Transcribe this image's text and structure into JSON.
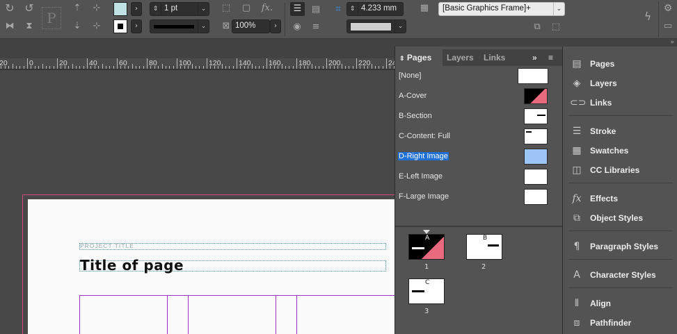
{
  "control_bar": {
    "stroke_weight": "1 pt",
    "scale_percent": "100%",
    "dimension_value": "4.233 mm",
    "object_style": "[Basic Graphics Frame]+",
    "colors": {
      "fill_swatch": "#bfe3e3",
      "stroke_swatch": "#000000"
    },
    "icons": [
      "rotate-left-icon",
      "rotate-right-icon",
      "text-frame-icon",
      "flip-horizontal-icon",
      "flip-vertical-icon",
      "select-content-icon",
      "select-container-icon",
      "fx-icon",
      "align-icon",
      "lightning-icon",
      "gear-icon"
    ]
  },
  "ruler": {
    "labels": [
      "20",
      "0",
      "20",
      "40",
      "60",
      "80",
      "100",
      "120",
      "140",
      "160",
      "180",
      "200",
      "220",
      "24"
    ]
  },
  "document": {
    "project_title": "PROJECT TITLE",
    "page_title": "Title of page",
    "colors": {
      "bleed": "#d6477d",
      "frames": "#9b2fc8",
      "baseline": "#4a8fb5"
    }
  },
  "pages_panel": {
    "tabs": [
      "Pages",
      "Layers",
      "Links"
    ],
    "active_tab": "Pages",
    "masters": [
      {
        "label": "[None]"
      },
      {
        "label": "A-Cover"
      },
      {
        "label": "B-Section"
      },
      {
        "label": "C-Content: Full"
      },
      {
        "label": "D-Right Image",
        "selected": true
      },
      {
        "label": "E-Left Image"
      },
      {
        "label": "F-Large Image"
      }
    ],
    "pages": [
      {
        "number": "1",
        "master": "A"
      },
      {
        "number": "2",
        "master": "B"
      },
      {
        "number": "3",
        "master": "C"
      }
    ],
    "colors": {
      "cover_accent": "#e9697f",
      "selected": "#1f6fd4"
    }
  },
  "right_dock": {
    "items": [
      {
        "label": "Pages",
        "icon": "pages-icon"
      },
      {
        "label": "Layers",
        "icon": "layers-icon"
      },
      {
        "label": "Links",
        "icon": "links-icon"
      },
      {
        "label": "Stroke",
        "icon": "stroke-icon"
      },
      {
        "label": "Swatches",
        "icon": "swatches-icon"
      },
      {
        "label": "CC Libraries",
        "icon": "cc-libraries-icon"
      },
      {
        "label": "Effects",
        "icon": "fx-icon"
      },
      {
        "label": "Object Styles",
        "icon": "object-styles-icon"
      },
      {
        "label": "Paragraph Styles",
        "icon": "paragraph-styles-icon"
      },
      {
        "label": "Character Styles",
        "icon": "character-styles-icon"
      },
      {
        "label": "Align",
        "icon": "align-icon"
      },
      {
        "label": "Pathfinder",
        "icon": "pathfinder-icon"
      }
    ]
  }
}
